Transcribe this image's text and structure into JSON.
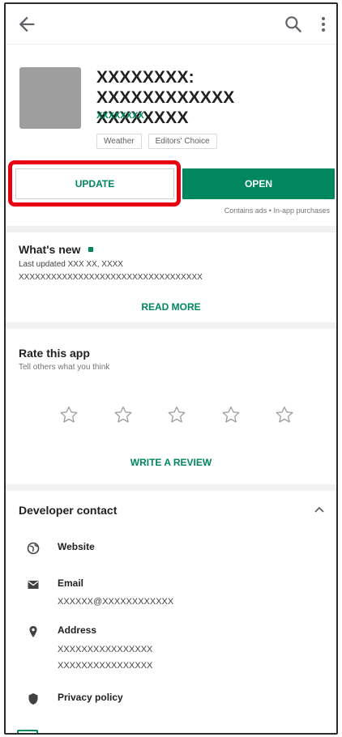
{
  "toolbar": {
    "back_icon": "arrow-back-icon",
    "search_icon": "search-icon",
    "more_icon": "more-vert-icon"
  },
  "app": {
    "title": "XXXXXXXX: XXXXXXXXXXXX XXXXXXXX",
    "developer": "XXXXXXXX",
    "tags": [
      "Weather",
      "Editors' Choice"
    ],
    "update_label": "UPDATE",
    "open_label": "OPEN",
    "purchase_note": "Contains ads • In-app purchases"
  },
  "whats_new": {
    "title": "What's new",
    "last_updated": "Last updated XXX XX, XXXX",
    "notes": "XXXXXXXXXXXXXXXXXXXXXXXXXXXXXXXXXX",
    "read_more": "READ MORE"
  },
  "rate": {
    "title": "Rate this app",
    "subtitle": "Tell others what you think",
    "stars": 5,
    "write_review": "WRITE A REVIEW"
  },
  "developer_contact": {
    "title": "Developer contact",
    "website_label": "Website",
    "email_label": "Email",
    "email_value": "XXXXXX@XXXXXXXXXXXX",
    "address_label": "Address",
    "address_line1": "XXXXXXXXXXXXXXXX",
    "address_line2": "XXXXXXXXXXXXXXXX",
    "privacy_label": "Privacy policy"
  },
  "colors": {
    "accent": "#01875f",
    "highlight": "#e60012"
  }
}
